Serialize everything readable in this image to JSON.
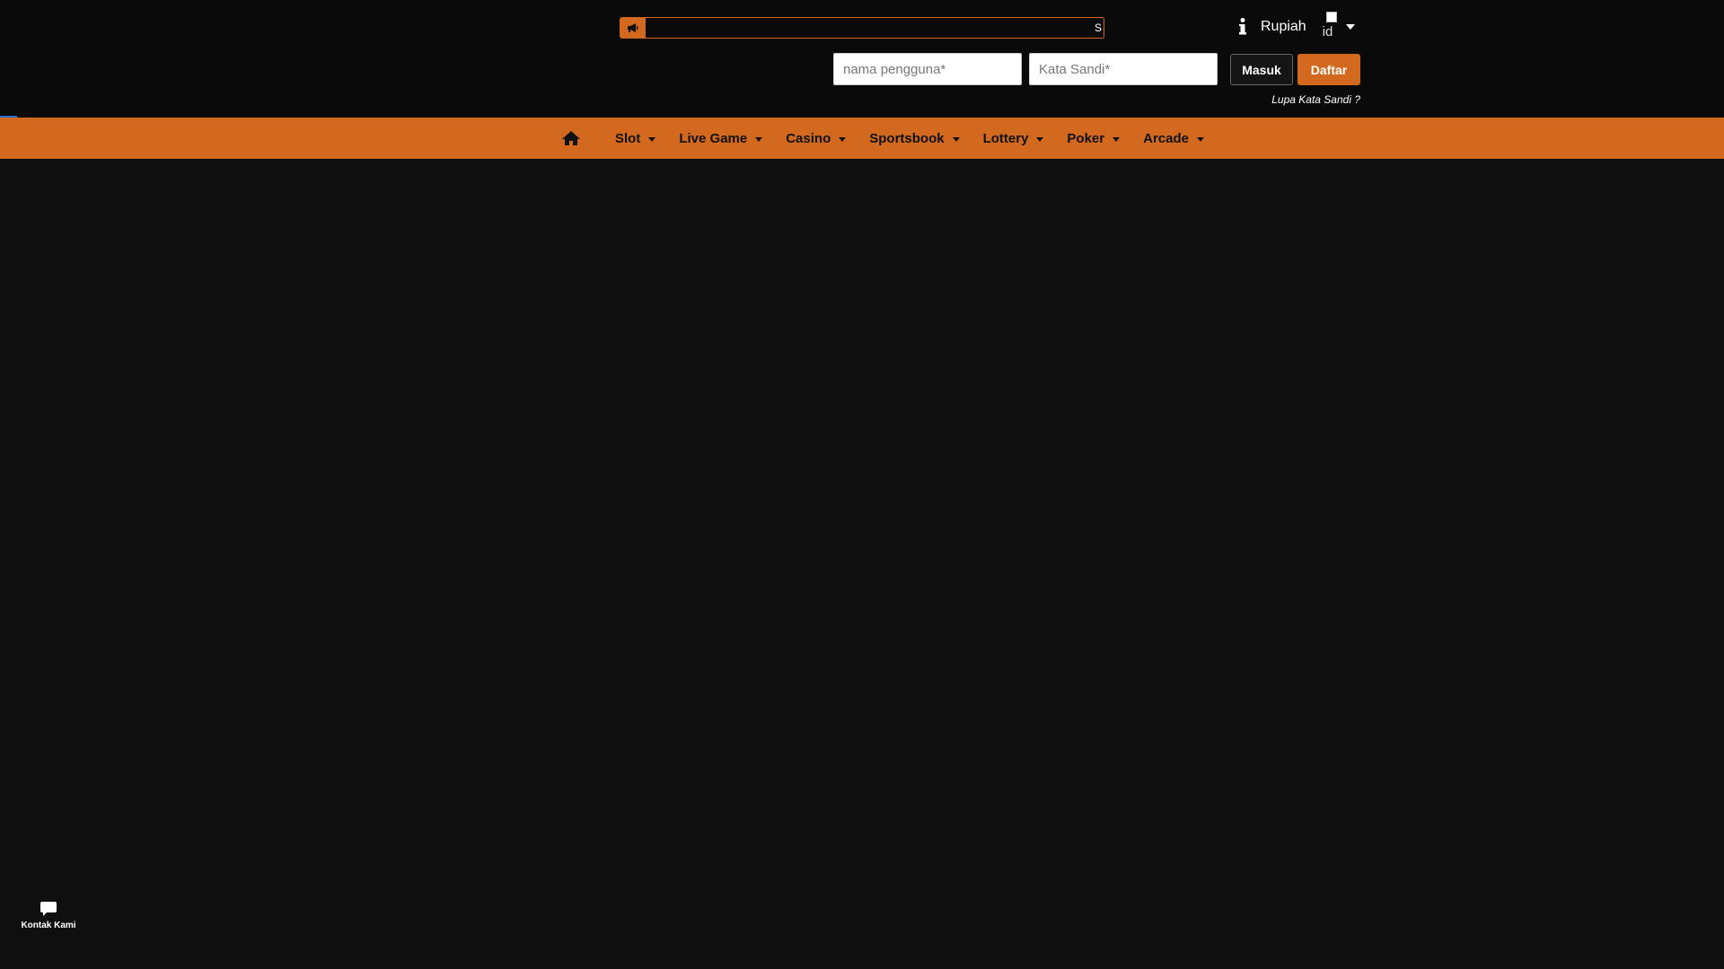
{
  "header": {
    "announcement": {
      "icon": "megaphone-icon",
      "text": "S"
    },
    "currency": "Rupiah",
    "language": {
      "flag_alt": "id"
    },
    "login": {
      "username_placeholder": "nama pengguna*",
      "password_placeholder": "Kata Sandi*",
      "login_label": "Masuk",
      "register_label": "Daftar",
      "forgot_label": "Lupa Kata Sandi ?"
    }
  },
  "nav": {
    "home_icon": "home-icon",
    "items": [
      {
        "label": "Slot"
      },
      {
        "label": "Live Game"
      },
      {
        "label": "Casino"
      },
      {
        "label": "Sportsbook"
      },
      {
        "label": "Lottery"
      },
      {
        "label": "Poker"
      },
      {
        "label": "Arcade"
      }
    ]
  },
  "contact": {
    "icon": "chat-bubble-icon",
    "label": "Kontak Kami"
  },
  "colors": {
    "accent": "#d2691e",
    "background": "#0f0f10",
    "topbar": "#0a0a0a"
  }
}
